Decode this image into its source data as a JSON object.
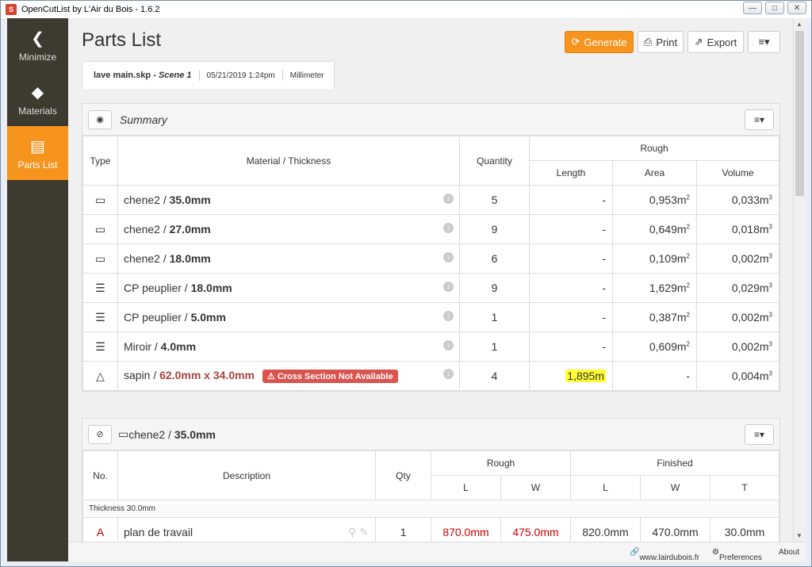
{
  "window": {
    "title": "OpenCutList by L'Air du Bois - 1.6.2",
    "controls": [
      "minimize",
      "maximize",
      "close"
    ]
  },
  "sidebar": {
    "items": [
      {
        "label": "Minimize",
        "icon": "chevron-left-icon"
      },
      {
        "label": "Materials",
        "icon": "paint-bucket-icon"
      },
      {
        "label": "Parts List",
        "icon": "list-icon"
      }
    ]
  },
  "header": {
    "title": "Parts List",
    "buttons": {
      "generate": "Generate",
      "print": "Print",
      "export": "Export"
    }
  },
  "tab": {
    "file": "lave main.skp",
    "scene": "Scene 1",
    "date": "05/21/2019 1:24pm",
    "unit": "Millimeter"
  },
  "summary": {
    "title": "Summary",
    "columns": {
      "type": "Type",
      "material": "Material / Thickness",
      "quantity": "Quantity",
      "rough": "Rough",
      "length": "Length",
      "area": "Area",
      "volume": "Volume"
    },
    "rows": [
      {
        "icon": "solid-wood-icon",
        "name": "chene2 / ",
        "thick": "35.0mm",
        "qty": "5",
        "length": "-",
        "area": "0,953m",
        "volume": "0,033m"
      },
      {
        "icon": "solid-wood-icon",
        "name": "chene2 / ",
        "thick": "27.0mm",
        "qty": "9",
        "length": "-",
        "area": "0,649m",
        "volume": "0,018m"
      },
      {
        "icon": "solid-wood-icon",
        "name": "chene2 / ",
        "thick": "18.0mm",
        "qty": "6",
        "length": "-",
        "area": "0,109m",
        "volume": "0,002m"
      },
      {
        "icon": "sheet-good-icon",
        "name": "CP peuplier / ",
        "thick": "18.0mm",
        "qty": "9",
        "length": "-",
        "area": "1,629m",
        "volume": "0,029m"
      },
      {
        "icon": "sheet-good-icon",
        "name": "CP peuplier / ",
        "thick": "5.0mm",
        "qty": "1",
        "length": "-",
        "area": "0,387m",
        "volume": "0,002m"
      },
      {
        "icon": "sheet-good-icon",
        "name": "Miroir / ",
        "thick": "4.0mm",
        "qty": "1",
        "length": "-",
        "area": "0,609m",
        "volume": "0,002m"
      },
      {
        "icon": "dimensional-icon",
        "name": "sapin / ",
        "thick": "62.0mm x 34.0mm",
        "warning": "Cross Section Not Available",
        "qty": "4",
        "length": "1,895m",
        "area": "-",
        "volume": "0,004m"
      }
    ]
  },
  "group": {
    "name": "chene2 / ",
    "thick": "35.0mm",
    "columns": {
      "no": "No.",
      "desc": "Description",
      "qty": "Qty",
      "rough": "Rough",
      "finished": "Finished",
      "L": "L",
      "W": "W",
      "T": "T"
    },
    "subheader": "Thickness 30.0mm",
    "rows": [
      {
        "no": "A",
        "desc": "plan de travail",
        "qty": "1",
        "rL": "870.0mm",
        "rW": "475.0mm",
        "fL": "820.0mm",
        "fW": "470.0mm",
        "fT": "30.0mm"
      }
    ]
  },
  "footer": {
    "website": "www.lairdubois.fr",
    "preferences": "Preferences",
    "about": "About"
  }
}
